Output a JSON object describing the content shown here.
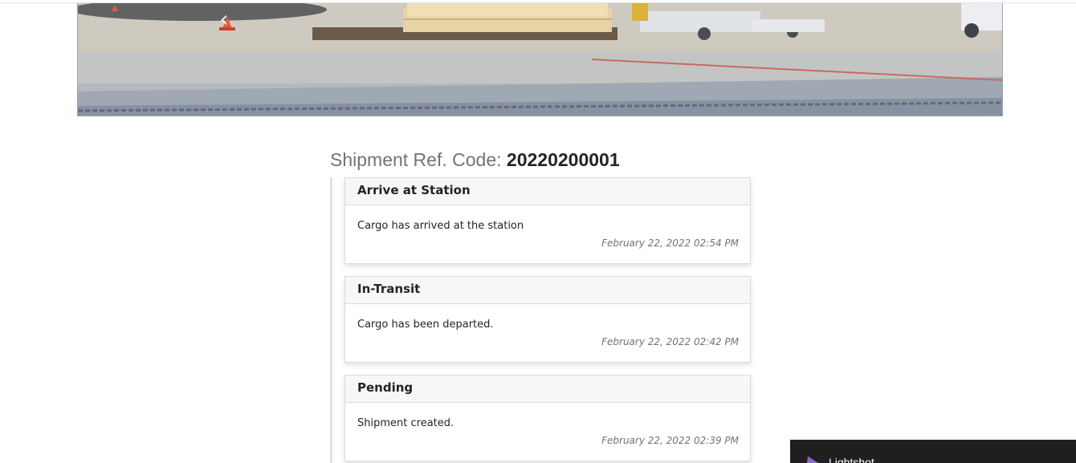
{
  "carousel": {
    "prev_icon": "chevron-left-icon",
    "prev_glyph": "‹",
    "next_icon": "chevron-right-icon",
    "next_glyph": "›"
  },
  "shipment": {
    "label": "Shipment Ref. Code:",
    "code": "20220200001"
  },
  "timeline": [
    {
      "status": "Arrive at Station",
      "message": "Cargo has arrived at the station",
      "timestamp": "February 22, 2022 02:54 PM"
    },
    {
      "status": "In-Transit",
      "message": "Cargo has been departed.",
      "timestamp": "February 22, 2022 02:42 PM"
    },
    {
      "status": "Pending",
      "message": "Shipment created.",
      "timestamp": "February 22, 2022 02:39 PM"
    }
  ],
  "lightshot": {
    "title": "Lightshot",
    "icon": "feather-icon",
    "icon_color": "#8b6cc8"
  },
  "colors": {
    "muted_text": "#6c757d",
    "dark_text": "#212529",
    "card_header_bg": "#f7f7f7",
    "timeline_line": "#dee2e6"
  }
}
